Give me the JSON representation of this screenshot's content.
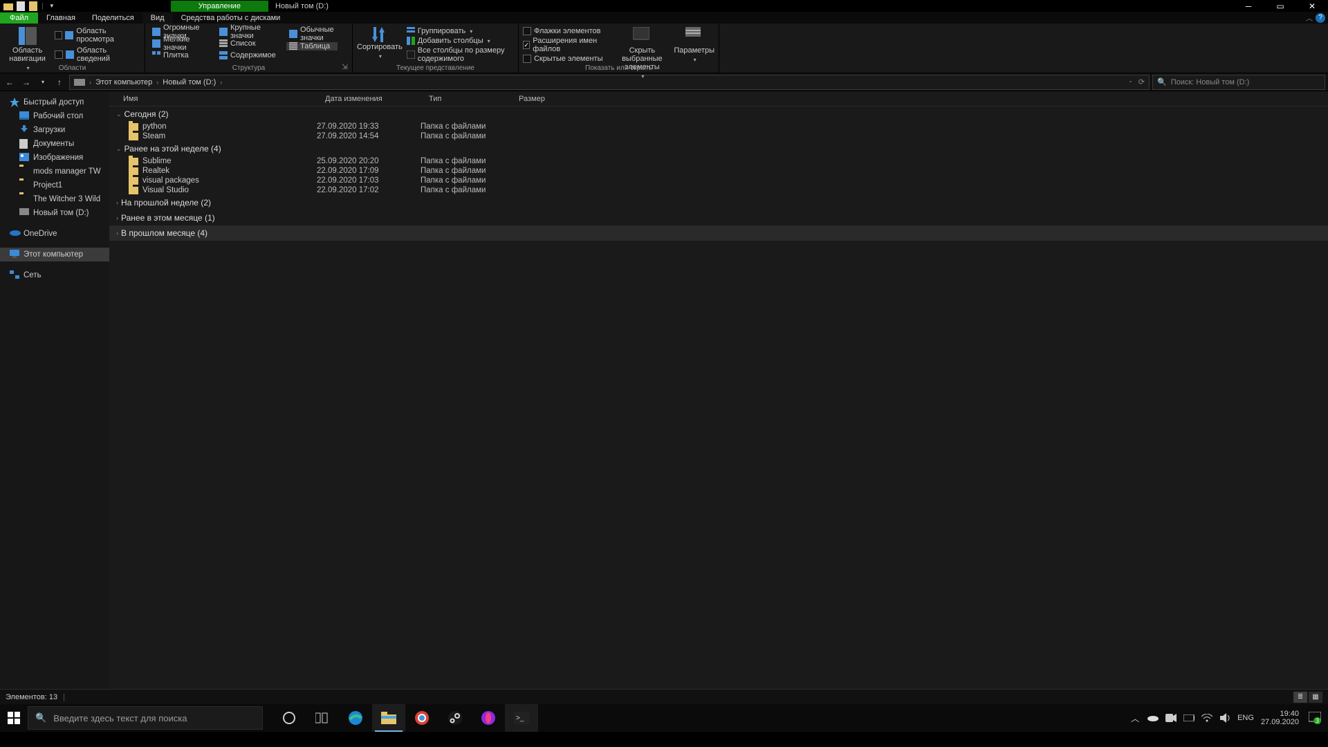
{
  "window": {
    "title": "Новый том (D:)"
  },
  "contextual_tab": "Управление",
  "tabs": {
    "file": "Файл",
    "home": "Главная",
    "share": "Поделиться",
    "view": "Вид",
    "drive_tools": "Средства работы с дисками"
  },
  "ribbon": {
    "panes": {
      "nav_pane": "Область навигации",
      "preview": "Область просмотра",
      "details": "Область сведений",
      "label": "Области"
    },
    "layout": {
      "xl": "Огромные значки",
      "lg": "Крупные значки",
      "md": "Обычные значки",
      "sm": "Мелкие значки",
      "list": "Список",
      "table": "Таблица",
      "tiles": "Плитка",
      "content": "Содержимое",
      "label": "Структура"
    },
    "view": {
      "sort": "Сортировать",
      "group": "Группировать",
      "add_cols": "Добавить столбцы",
      "size_cols": "Все столбцы по размеру содержимого",
      "label": "Текущее представление"
    },
    "showhide": {
      "checkboxes": "Флажки элементов",
      "extensions": "Расширения имен файлов",
      "hidden": "Скрытые элементы",
      "hide_selected": "Скрыть выбранные элементы",
      "options": "Параметры",
      "label": "Показать или скрыть"
    }
  },
  "breadcrumb": {
    "pc": "Этот компьютер",
    "drive": "Новый том (D:)"
  },
  "search": {
    "placeholder": "Поиск: Новый том (D:)"
  },
  "sidebar": {
    "quick": "Быстрый доступ",
    "desktop": "Рабочий стол",
    "downloads": "Загрузки",
    "documents": "Документы",
    "pictures": "Изображения",
    "mods": "mods manager TW",
    "project1": "Project1",
    "witcher": "The Witcher 3 Wild",
    "newvol": "Новый том (D:)",
    "onedrive": "OneDrive",
    "thispc": "Этот компьютер",
    "network": "Сеть"
  },
  "columns": {
    "name": "Имя",
    "date": "Дата изменения",
    "type": "Тип",
    "size": "Размер"
  },
  "type_folder": "Папка с файлами",
  "groups": {
    "today_label": "Сегодня (2)",
    "today": [
      {
        "name": "python",
        "date": "27.09.2020 19:33"
      },
      {
        "name": "Steam",
        "date": "27.09.2020 14:54"
      }
    ],
    "earlier_week_label": "Ранее на этой неделе (4)",
    "earlier_week": [
      {
        "name": "Sublime",
        "date": "25.09.2020 20:20"
      },
      {
        "name": "Realtek",
        "date": "22.09.2020 17:09"
      },
      {
        "name": "visual packages",
        "date": "22.09.2020 17:03"
      },
      {
        "name": "Visual Studio",
        "date": "22.09.2020 17:02"
      }
    ],
    "last_week_label": "На прошлой неделе (2)",
    "earlier_month_label": "Ранее в этом месяце (1)",
    "last_month_label": "В прошлом месяце (4)"
  },
  "status": {
    "count": "Элементов: 13"
  },
  "taskbar": {
    "search_placeholder": "Введите здесь текст для поиска",
    "lang": "ENG",
    "time": "19:40",
    "date": "27.09.2020",
    "notif_count": "3"
  }
}
